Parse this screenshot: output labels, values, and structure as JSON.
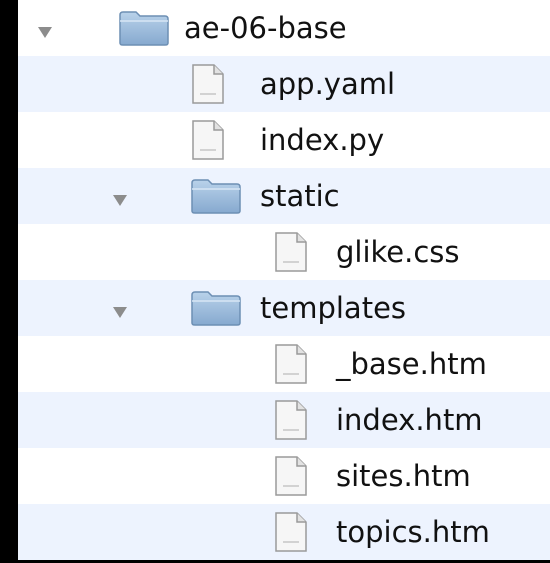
{
  "tree": [
    {
      "name": "ae-06-base",
      "type": "folder",
      "level": 0,
      "expanded": true,
      "icon": "folder-icon"
    },
    {
      "name": "app.yaml",
      "type": "file",
      "level": 1,
      "icon": "document-icon"
    },
    {
      "name": "index.py",
      "type": "file",
      "level": 1,
      "icon": "document-icon"
    },
    {
      "name": "static",
      "type": "folder",
      "level": 1,
      "expanded": true,
      "icon": "folder-icon"
    },
    {
      "name": "glike.css",
      "type": "file",
      "level": 2,
      "icon": "document-icon"
    },
    {
      "name": "templates",
      "type": "folder",
      "level": 1,
      "expanded": true,
      "icon": "folder-icon"
    },
    {
      "name": "_base.htm",
      "type": "file",
      "level": 2,
      "icon": "document-icon"
    },
    {
      "name": "index.htm",
      "type": "file",
      "level": 2,
      "icon": "document-icon"
    },
    {
      "name": "sites.htm",
      "type": "file",
      "level": 2,
      "icon": "document-icon"
    },
    {
      "name": "topics.htm",
      "type": "file",
      "level": 2,
      "icon": "document-icon"
    }
  ],
  "colors": {
    "background": "#000000",
    "row_white": "#ffffff",
    "row_stripe": "#edf3fe",
    "folder": "#9fbedd",
    "text": "#111111",
    "disclosure": "#8c8c8c"
  }
}
